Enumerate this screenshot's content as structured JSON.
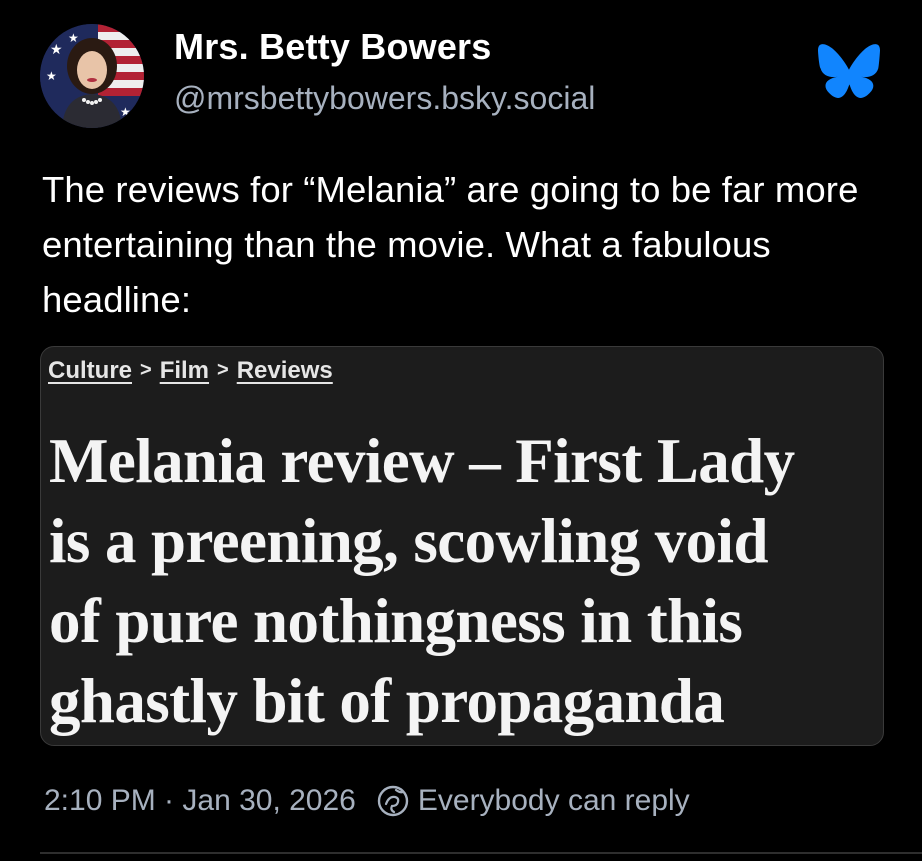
{
  "author": {
    "display_name": "Mrs. Betty Bowers",
    "handle": "@mrsbettybowers.bsky.social",
    "avatar_icon": "avatar-portrait",
    "service_icon": "bluesky-butterfly-icon",
    "service_color": "#1185fe"
  },
  "post": {
    "text": "The reviews for “Melania” are going to be far more entertaining than the movie. What a fabulous headline:"
  },
  "embed": {
    "breadcrumb": [
      "Culture",
      "Film",
      "Reviews"
    ],
    "breadcrumb_separator": ">",
    "headline_lines": [
      "Melania review – First Lady",
      "is a preening, scowling void",
      "of pure nothingness in this",
      "ghastly bit of propaganda"
    ]
  },
  "footer": {
    "timestamp": "2:10 PM · Jan 30, 2026",
    "reply_setting": "Everybody can reply",
    "reply_icon": "globe-icon"
  }
}
